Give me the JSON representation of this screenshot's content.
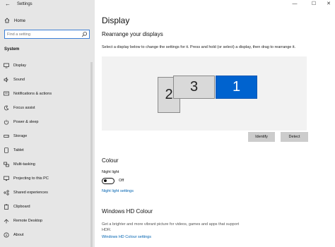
{
  "window": {
    "title": "Settings",
    "back_glyph": "←",
    "minimize_glyph": "—",
    "maximize_glyph": "☐",
    "close_glyph": "✕"
  },
  "sidebar": {
    "home_label": "Home",
    "search_placeholder": "Find a setting",
    "section_title": "System",
    "items": [
      {
        "label": "Display",
        "icon": "display-icon"
      },
      {
        "label": "Sound",
        "icon": "sound-icon"
      },
      {
        "label": "Notifications & actions",
        "icon": "notifications-icon"
      },
      {
        "label": "Focus assist",
        "icon": "focus-assist-icon"
      },
      {
        "label": "Power & sleep",
        "icon": "power-icon"
      },
      {
        "label": "Storage",
        "icon": "storage-icon"
      },
      {
        "label": "Tablet",
        "icon": "tablet-icon"
      },
      {
        "label": "Multi-tasking",
        "icon": "multitasking-icon"
      },
      {
        "label": "Projecting to this PC",
        "icon": "projecting-icon"
      },
      {
        "label": "Shared experiences",
        "icon": "shared-experiences-icon"
      },
      {
        "label": "Clipboard",
        "icon": "clipboard-icon"
      },
      {
        "label": "Remote Desktop",
        "icon": "remote-desktop-icon"
      },
      {
        "label": "About",
        "icon": "about-icon"
      }
    ]
  },
  "main": {
    "title": "Display",
    "rearrange_heading": "Rearrange your displays",
    "rearrange_desc": "Select a display below to change the settings for it. Press and hold (or select) a display, then drag to rearrange it.",
    "monitors": [
      {
        "number": "2",
        "selected": false
      },
      {
        "number": "3",
        "selected": false
      },
      {
        "number": "1",
        "selected": true
      }
    ],
    "identify_label": "Identify",
    "detect_label": "Detect",
    "colour_heading": "Colour",
    "night_light_label": "Night light",
    "night_light_state": "Off",
    "night_light_settings_link": "Night light settings",
    "hd_heading": "Windows HD Colour",
    "hd_desc": "Get a brighter and more vibrant picture for videos, games and apps that support HDR.",
    "hd_settings_link": "Windows HD Colour settings"
  },
  "colors": {
    "accent": "#0063cf",
    "link": "#0063b1",
    "sidebar_bg": "#e6e6e6"
  }
}
